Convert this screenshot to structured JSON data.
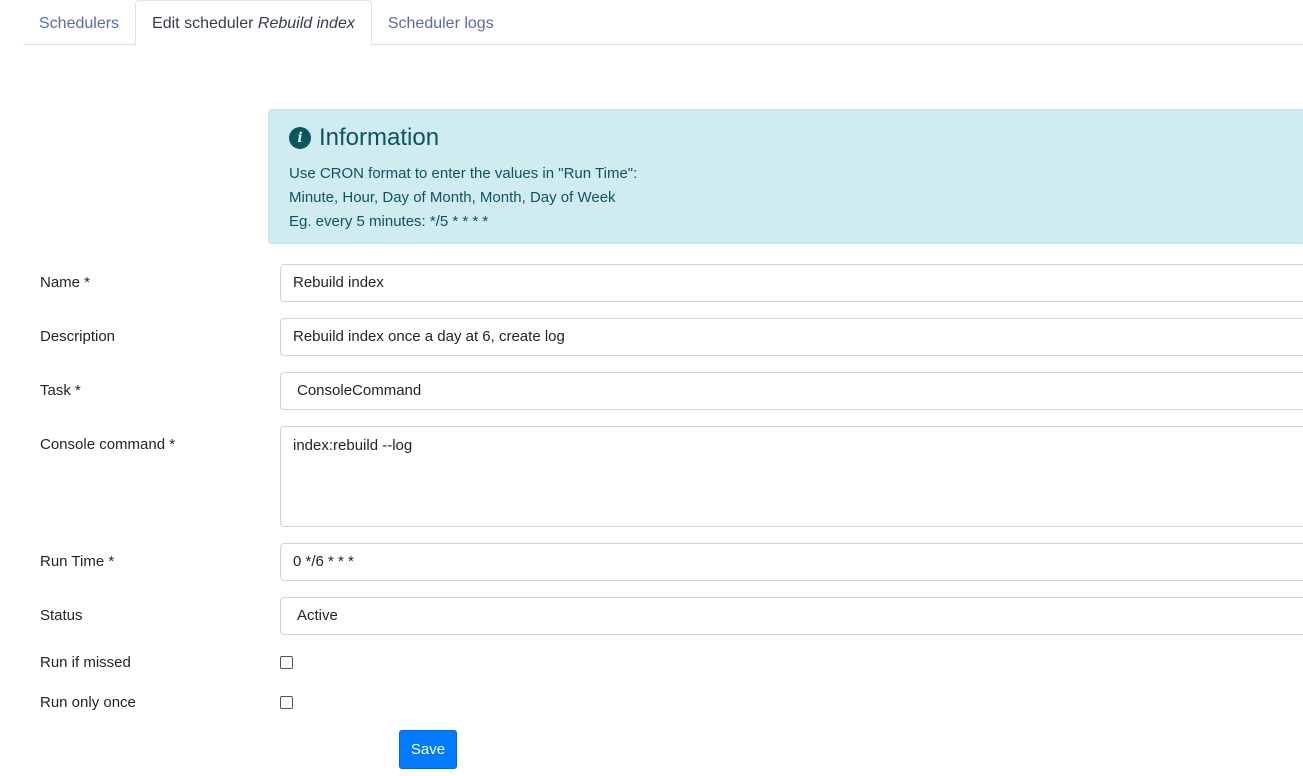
{
  "tabs": [
    {
      "label": "Schedulers"
    },
    {
      "label_prefix": "Edit scheduler ",
      "label_italic": "Rebuild index"
    },
    {
      "label": "Scheduler logs"
    }
  ],
  "info": {
    "title": "Information",
    "icon": "info-circle-icon",
    "lines": [
      "Use CRON format to enter the values in \"Run Time\":",
      "Minute, Hour, Day of Month, Month, Day of Week",
      "Eg. every 5 minutes: */5 * * * *"
    ]
  },
  "form": {
    "name": {
      "label": "Name *",
      "value": "Rebuild index"
    },
    "description": {
      "label": "Description",
      "value": "Rebuild index once a day at 6, create log"
    },
    "task": {
      "label": "Task *",
      "value": "ConsoleCommand"
    },
    "console_command": {
      "label": "Console command *",
      "value": "index:rebuild --log"
    },
    "run_time": {
      "label": "Run Time *",
      "value": "0 */6 * * *"
    },
    "status": {
      "label": "Status",
      "value": "Active"
    },
    "run_if_missed": {
      "label": "Run if missed",
      "checked": false
    },
    "run_only_once": {
      "label": "Run only once",
      "checked": false
    }
  },
  "save_label": "Save",
  "colors": {
    "info_bg": "#d1ecf1",
    "info_text": "#0c5460",
    "primary": "#007bff",
    "tab_link": "#5a6aa8"
  }
}
